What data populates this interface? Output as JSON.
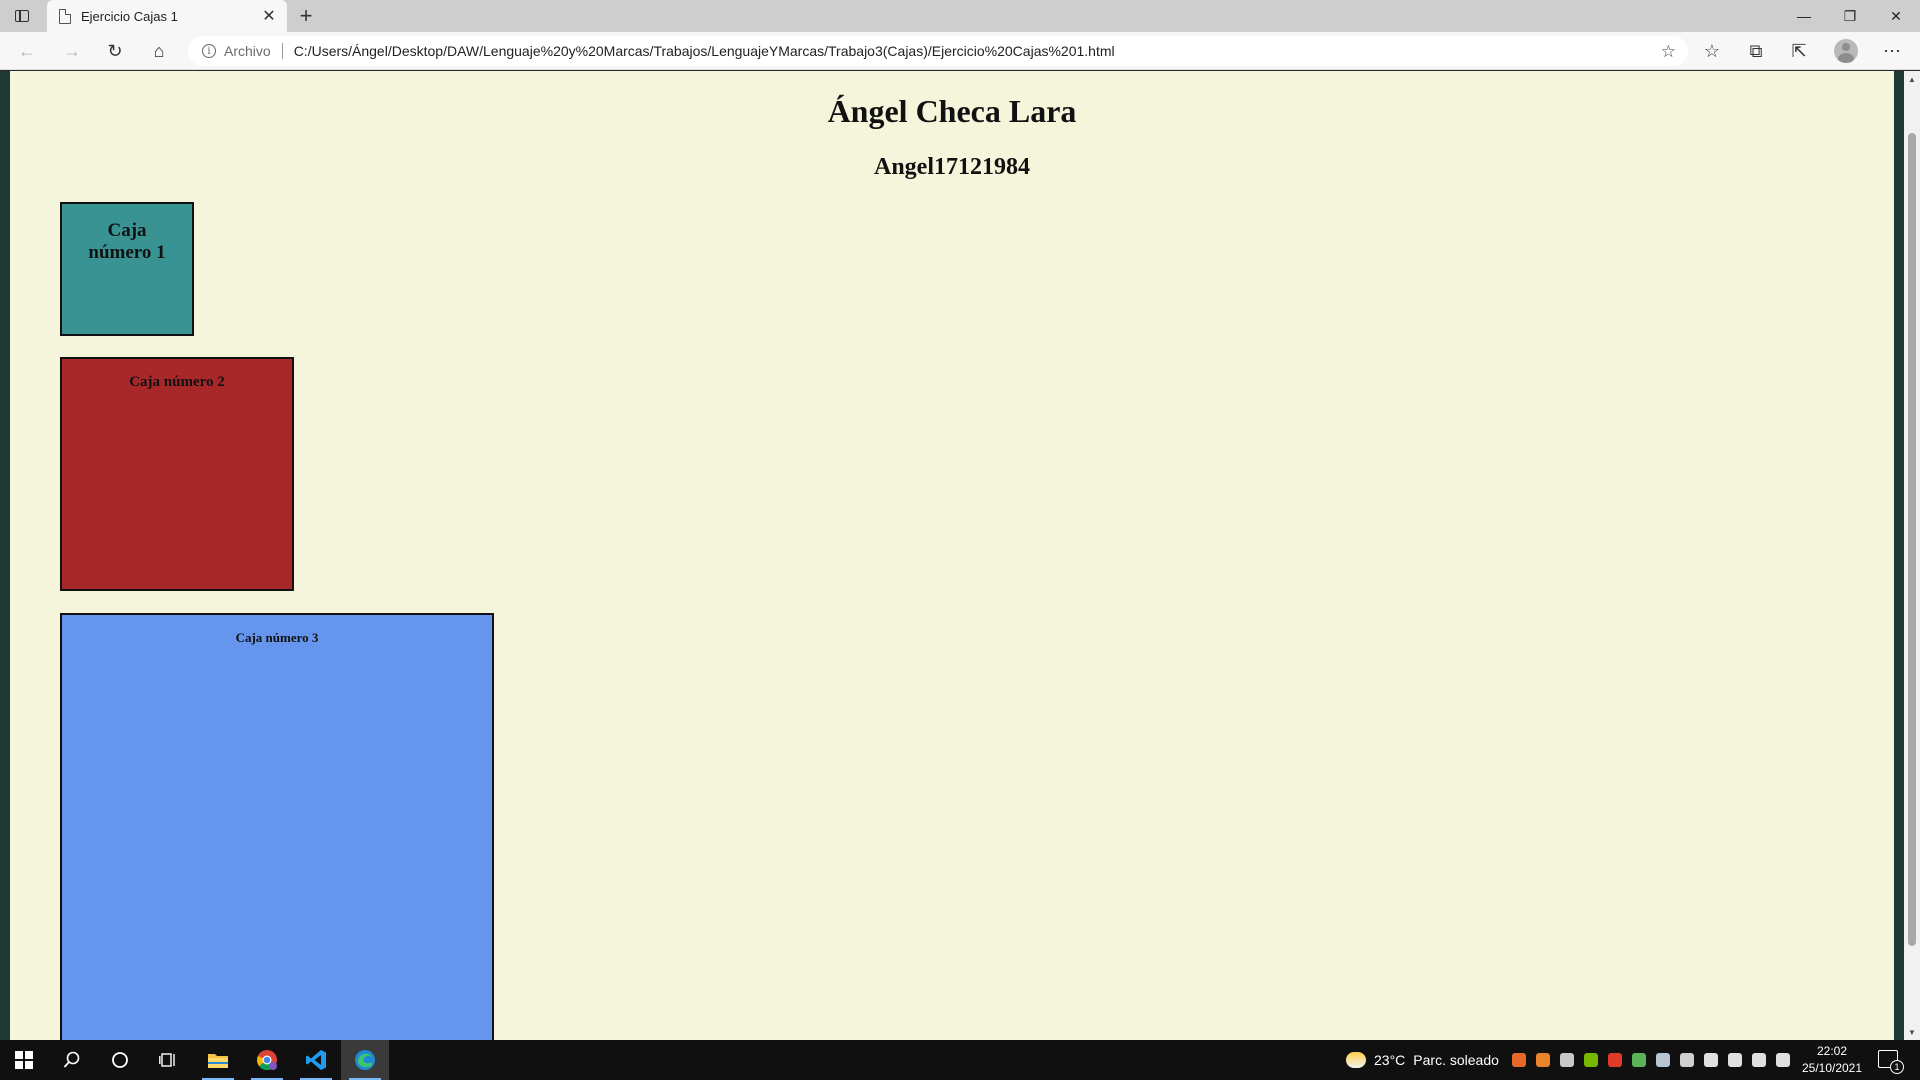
{
  "browser": {
    "tab_title": "Ejercicio Cajas 1",
    "address_scheme": "Archivo",
    "url": "C:/Users/Ángel/Desktop/DAW/Lenguaje%20y%20Marcas/Trabajos/LenguajeYMarcas/Trabajo3(Cajas)/Ejercicio%20Cajas%201.html"
  },
  "page": {
    "title": "Ángel Checa Lara",
    "subtitle": "Angel17121984",
    "boxes": [
      {
        "label": "Caja número 1",
        "color": "#3a9393"
      },
      {
        "label": "Caja número 2",
        "color": "#a8282a"
      },
      {
        "label": "Caja número 3",
        "color": "#6595ec"
      }
    ],
    "background": "#f5f5dc"
  },
  "taskbar": {
    "weather_temp": "23°C",
    "weather_desc": "Parc. soleado",
    "time": "22:02",
    "date": "25/10/2021",
    "notification_count": "1",
    "apps": [
      "windows-start-icon",
      "search-icon",
      "cortana-icon",
      "task-view-icon",
      "file-explorer-icon",
      "chrome-icon",
      "vscode-icon",
      "edge-icon"
    ]
  }
}
